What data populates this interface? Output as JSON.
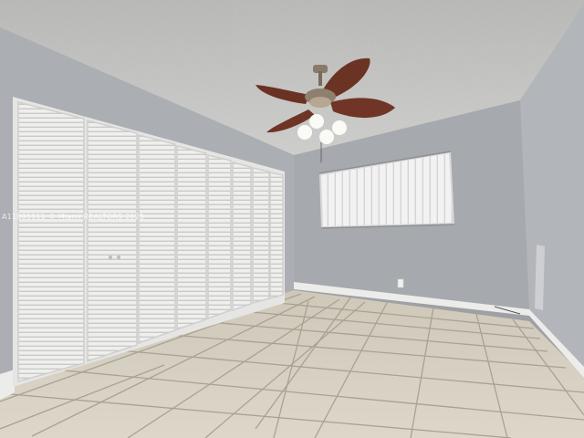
{
  "photo": {
    "watermark_text": "A11805911 © Miami REALTORS 2025"
  },
  "colors": {
    "ceiling": "#c9c9c7",
    "wall_left": "#aeb1b5",
    "wall_back": "#a7aaae",
    "wall_right": "#b3b6ba",
    "floor": "#d8d2c4",
    "grout": "#a39d90",
    "baseboard": "#ededeb",
    "closet_doors": "#eeeeec",
    "blinds": "#f1f1f1",
    "fan_blade": "#6a3324"
  }
}
